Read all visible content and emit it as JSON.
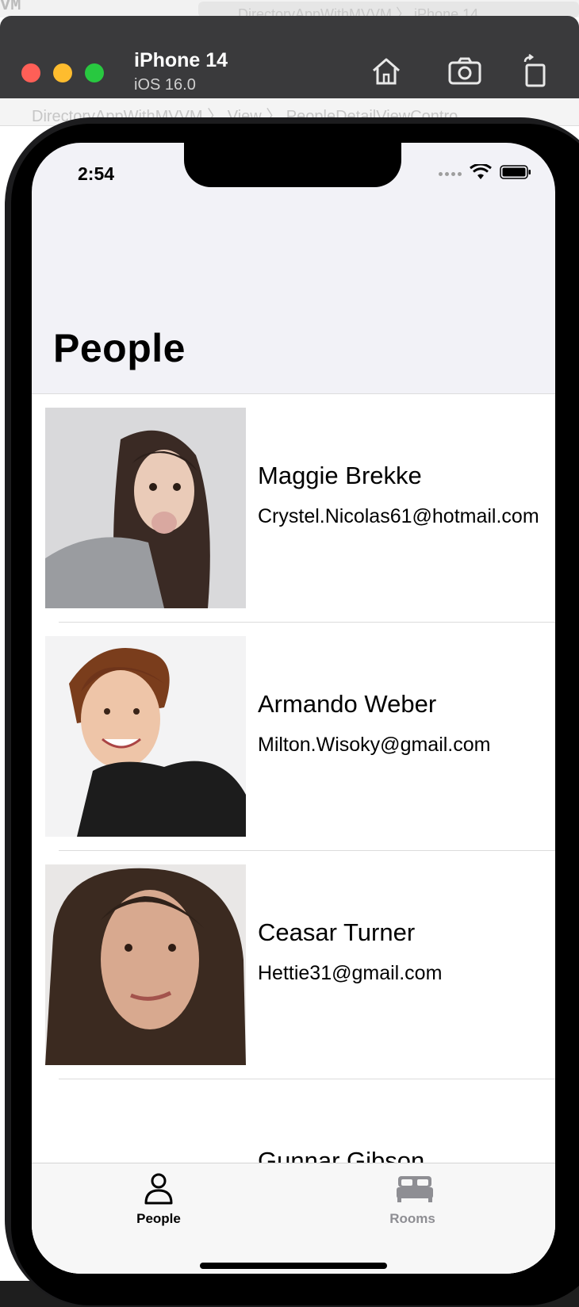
{
  "xcode": {
    "top_fragment": "VM",
    "top_ghost": "DirectoryAppWithMVVM 〉 iPhone 14",
    "breadcrumb": "DirectoryAppWithMVVM 〉 View 〉 PeopleDetailViewContro"
  },
  "simulator": {
    "device_name": "iPhone 14",
    "os_version": "iOS 16.0",
    "icons": [
      "home-icon",
      "screenshot-icon",
      "rotate-icon"
    ]
  },
  "status_bar": {
    "time": "2:54",
    "icons": [
      "signal-icon",
      "wifi-icon",
      "battery-icon"
    ]
  },
  "nav": {
    "title": "People"
  },
  "people": [
    {
      "name": "Maggie Brekke",
      "email": "Crystel.Nicolas61@hotmail.com"
    },
    {
      "name": "Armando Weber",
      "email": "Milton.Wisoky@gmail.com"
    },
    {
      "name": "Ceasar Turner",
      "email": "Hettie31@gmail.com"
    },
    {
      "name": "Gunnar Gibson",
      "email": ""
    }
  ],
  "tabs": [
    {
      "label": "People",
      "icon": "person-icon",
      "selected": true
    },
    {
      "label": "Rooms",
      "icon": "bed-icon",
      "selected": false
    }
  ],
  "colors": {
    "selected_tab": "#000000",
    "unselected_tab": "#8e8e93",
    "traffic_red": "#ff5f57",
    "traffic_yellow": "#febc2e",
    "traffic_green": "#28c840"
  }
}
